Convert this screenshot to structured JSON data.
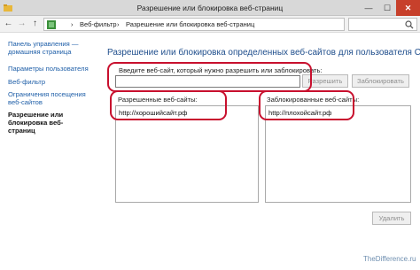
{
  "window": {
    "title": "Разрешение или блокировка веб-страниц",
    "controls": {
      "minimize": "—",
      "maximize": "☐",
      "close": "✕"
    }
  },
  "addressbar": {
    "breadcrumbs": [
      "Веб-фильтр",
      "Разрешение или блокировка веб-страниц"
    ],
    "separator": "›",
    "refresh_glyph": "↻",
    "search_placeholder": ""
  },
  "nav": {
    "back": "←",
    "forward": "→",
    "up": "↑"
  },
  "sidebar": {
    "items": [
      {
        "label": "Панель управления — домашняя страница",
        "active": false
      },
      {
        "label": "Параметры пользователя",
        "active": false
      },
      {
        "label": "Веб-фильтр",
        "active": false
      },
      {
        "label": "Ограничения посещения веб-сайтов",
        "active": false
      },
      {
        "label": "Разрешение или блокировка веб-страниц",
        "active": true
      }
    ]
  },
  "main": {
    "heading": "Разрешение или блокировка определенных веб-сайтов для пользователя Сын",
    "enter_label": "Введите веб-сайт, который нужно разрешить или заблокировать:",
    "site_input_value": "",
    "allow_button": "Разрешить",
    "block_button": "Заблокировать",
    "allowed_label": "Разрешенные веб-сайты:",
    "allowed_sites": [
      "http://хорошийсайт.рф"
    ],
    "blocked_label": "Заблокированные веб-сайты:",
    "blocked_sites": [
      "http://плохойсайт.рф"
    ],
    "delete_button": "Удалить"
  },
  "watermark": "TheDifference.ru",
  "colors": {
    "highlight": "#c8102e",
    "link": "#1f5fa8",
    "heading": "#1f4e8c",
    "close_button": "#c7402b"
  },
  "icons": [
    "app-icon",
    "back-arrow-icon",
    "forward-arrow-icon",
    "up-arrow-icon",
    "address-icon",
    "refresh-icon",
    "search-icon"
  ]
}
